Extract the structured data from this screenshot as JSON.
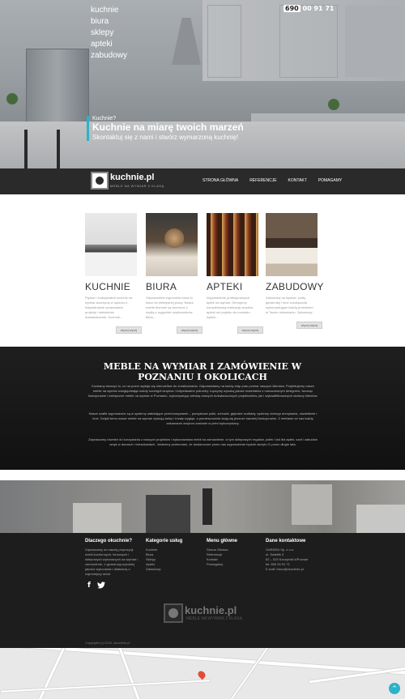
{
  "top_nav": {
    "items": [
      "kuchnie",
      "biura",
      "sklepy",
      "apteki",
      "zabudowy"
    ]
  },
  "phone": {
    "prefix": "690",
    "rest": "00 91 71"
  },
  "hero": {
    "kicker": "Kuchnie?",
    "headline": "Kuchnie na miarę twoich marzeń",
    "subline": "Skontaktuj się z nami i stwórz wymarzoną kuchnię!"
  },
  "logo": {
    "name": "kuchnie.pl",
    "tagline": "MEBLE NA WYMIAR Z KLASĄ"
  },
  "main_nav": {
    "items": [
      "STRONA GŁÓWNA",
      "REFERENCJE",
      "KONTAKT",
      "POMAGAMY"
    ]
  },
  "cards": [
    {
      "title": "KUCHNIE",
      "text": "Piękne i funkcjonalne kuchnie na wymiar tworzymy w oparciu o indywidualnie opracowane projekty i wieloletnie doświadczenie. Kuchnie...",
      "button": "więcej więcej"
    },
    {
      "title": "BIURA",
      "text": "Odpowiednia ergonomia biura to klucz do efektywnej pracy. Nasze meble biurowe są tworzone z myślą o wygodzie użytkowników. Biuro...",
      "button": "więcej więcej"
    },
    {
      "title": "APTEKI",
      "text": "Wyposażenie profesjonalnych aptek na wymiar. Oferujemy kompleksową realizację wnętrza apteki od projektu do montażu. Apteki...",
      "button": "więcej więcej"
    },
    {
      "title": "ZABUDOWY",
      "text": "Zabudowy na wymiar, szafy, garderoby i inne rozwiązania wykorzystujące każdą przestrzeń w Twoim mieszkaniu. Zabudowy...",
      "button": "więcej więcej"
    }
  ],
  "about": {
    "title": "MEBLE NA WYMIAR I ZAMÓWIENIE W POZNANIU I OKOLICACH",
    "p1": "Kochamy tworzyć to, co na pozór wydaje się niemożliwe do zrealizowania. Odpowiadamy na każdy etap prac pomiar naszych klientów. Projektujemy nasze meble na wymiar uwzględniając każdy szczegół wnętrza i indywidualne potrzeby. Łączymy wysoką jakość materiałów z nowoczesnym designem, tworząc funkcjonalne i estetyczne meble na wymiar w Poznaniu, wykorzystując wiedzę naszych doświadczonych projektantów, jak i wykwalifikowanych stolarzy klientów.",
    "p2": "Nasze szafki wyposażone są w systemy ułatwiające przechowywanie – pomysłowe półki, schowki, głębokie szuflady, systemy cichego domykania, oświetlenie i inne. Dzięki temu nasze meble na wymiar zyskują ładny i trwały wygląd, a pomieszczenia stają się jeszcze bardziej funkcjonalne. Z meblami od nas każdy zakamarek wnętrza zostanie w pełni wykorzystany.",
    "p3": "Zapraszamy również do korzystania z naszych projektów i wykonawstwa mebli na zamówienie, w tym sklepowych regałów, półek i lad dla aptek, szaf i zabudów wnęk w domach i mieszkaniach. Jesteśmy przekonani, że dostarczone przez nas wyposażenie będzie służyło Ci przez długie lata."
  },
  "footer": {
    "col1": {
      "heading": "Dlaczego okuchnie?",
      "text": "Zapraszamy do naszej propozycji mebli kuchennych, biurowych i sklepowych wykonanych na wymiar i zamówienie, z gwarancją wysokiej jakości wykonania i dbałością o najmniejszy detal."
    },
    "col2": {
      "heading": "Kategorie usług",
      "items": [
        "Kuchnie",
        "Biura",
        "Sklepy",
        "Apteki",
        "Zabudowy"
      ]
    },
    "col3": {
      "heading": "Menu główne",
      "items": [
        "Strona Główna",
        "Referencje",
        "Kontakt",
        "Pomagamy"
      ]
    },
    "col4": {
      "heading": "Dane kontaktowe",
      "lines": [
        "GARDEN Sp. z o.o.",
        "ul. Świetlik 3",
        "62 – 023 Szczytniki k/Poznań",
        "tel: 690 00 91 71",
        "E-mail: biuro@okuchnie.pl"
      ]
    },
    "logo_name": "kuchnie.pl",
    "logo_tag": "MEBLE NA WYMIAR Z KLASĄ",
    "copyright": "Copyright (c) 2016, okuchnie.pl"
  },
  "colors": {
    "accent": "#2bb3c7",
    "dark": "#1d1d1d",
    "pin": "#e14c35"
  },
  "icons": [
    "facebook-icon",
    "twitter-icon",
    "map-pin-icon",
    "arrow-up-icon"
  ]
}
